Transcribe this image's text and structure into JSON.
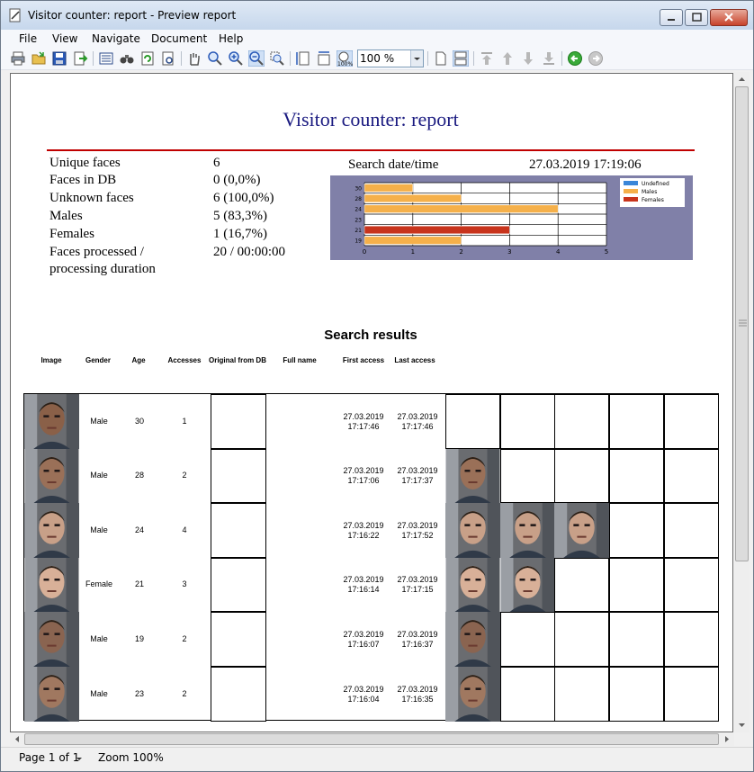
{
  "window": {
    "title": "Visitor counter: report - Preview report"
  },
  "menu": [
    "File",
    "View",
    "Navigate",
    "Document",
    "Help"
  ],
  "toolbar": {
    "zoom_value": "100 %"
  },
  "report": {
    "title": "Visitor counter: report",
    "stats": [
      {
        "label": "Unique faces",
        "value": "6"
      },
      {
        "label": "Faces in DB",
        "value": "0 (0,0%)"
      },
      {
        "label": "Unknown faces",
        "value": "6 (100,0%)"
      },
      {
        "label": "Males",
        "value": "5 (83,3%)"
      },
      {
        "label": "Females",
        "value": "1 (16,7%)"
      },
      {
        "label": "Faces processed /\nprocessing duration",
        "value": "20 / 00:00:00"
      }
    ],
    "search_datetime_label": "Search date/time",
    "search_datetime_value": "27.03.2019 17:19:06",
    "section_title": "Search results",
    "columns": [
      "Image",
      "Gender",
      "Age",
      "Accesses",
      "Original from DB",
      "Full name",
      "First access",
      "Last access"
    ],
    "rows": [
      {
        "gender": "Male",
        "age": "30",
        "accesses": "1",
        "first": "27.03.2019\n17:17:46",
        "last": "27.03.2019\n17:17:46",
        "extra_faces": 0,
        "skin": "#8a6048"
      },
      {
        "gender": "Male",
        "age": "28",
        "accesses": "2",
        "first": "27.03.2019\n17:17:06",
        "last": "27.03.2019\n17:17:37",
        "extra_faces": 1,
        "skin": "#9a7058"
      },
      {
        "gender": "Male",
        "age": "24",
        "accesses": "4",
        "first": "27.03.2019\n17:16:22",
        "last": "27.03.2019\n17:17:52",
        "extra_faces": 3,
        "skin": "#c8a088"
      },
      {
        "gender": "Female",
        "age": "21",
        "accesses": "3",
        "first": "27.03.2019\n17:16:14",
        "last": "27.03.2019\n17:17:15",
        "extra_faces": 2,
        "skin": "#d8b098"
      },
      {
        "gender": "Male",
        "age": "19",
        "accesses": "2",
        "first": "27.03.2019\n17:16:07",
        "last": "27.03.2019\n17:16:37",
        "extra_faces": 1,
        "skin": "#8a6450"
      },
      {
        "gender": "Male",
        "age": "23",
        "accesses": "2",
        "first": "27.03.2019\n17:16:04",
        "last": "27.03.2019\n17:16:35",
        "extra_faces": 1,
        "skin": "#a07860"
      }
    ]
  },
  "chart_data": {
    "type": "bar",
    "orientation": "horizontal",
    "categories": [
      "30",
      "28",
      "24",
      "23",
      "21",
      "19"
    ],
    "series": [
      {
        "name": "Undefined",
        "values": [
          0,
          0,
          0,
          0,
          0,
          0
        ],
        "color": "#3a86d8"
      },
      {
        "name": "Males",
        "values": [
          1,
          2,
          4,
          0,
          0,
          2
        ],
        "color": "#f5b04a"
      },
      {
        "name": "Females",
        "values": [
          0,
          0,
          0,
          0,
          3,
          0
        ],
        "color": "#c8341c"
      }
    ],
    "xticks": [
      "0",
      "1",
      "2",
      "3",
      "4",
      "5"
    ],
    "xlim": [
      0,
      5
    ],
    "legend": "top-right",
    "grid": true
  },
  "status": {
    "page": "Page 1 of 1",
    "zoom": "Zoom 100%"
  }
}
